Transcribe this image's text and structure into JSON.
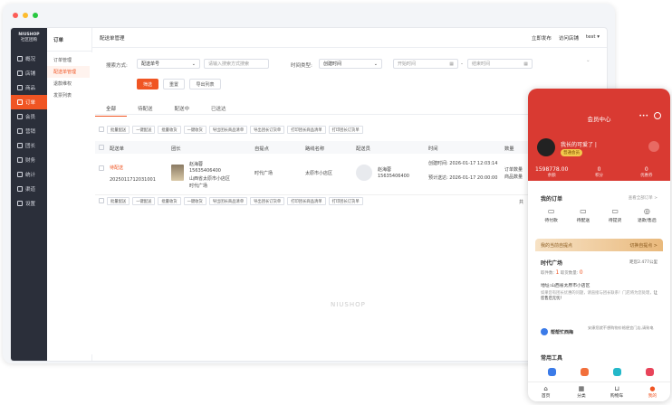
{
  "colors": {
    "accent": "#f05523",
    "phone_red": "#d93a32"
  },
  "window": {
    "dots": [
      "#fc5d57",
      "#fdbc2e",
      "#28c840"
    ]
  },
  "sidebar": {
    "logo": "NIUSHOP",
    "logo_sub": "社区团购",
    "items": [
      {
        "label": "概况",
        "icon": "dashboard-icon"
      },
      {
        "label": "店铺",
        "icon": "shop-icon"
      },
      {
        "label": "商品",
        "icon": "goods-icon"
      },
      {
        "label": "订单",
        "icon": "order-icon"
      },
      {
        "label": "会员",
        "icon": "member-icon"
      },
      {
        "label": "营销",
        "icon": "marketing-icon"
      },
      {
        "label": "团长",
        "icon": "leader-icon"
      },
      {
        "label": "财务",
        "icon": "finance-icon"
      },
      {
        "label": "统计",
        "icon": "stats-icon"
      },
      {
        "label": "渠道",
        "icon": "channel-icon"
      },
      {
        "label": "设置",
        "icon": "settings-icon"
      }
    ]
  },
  "submenu": {
    "title": "订单",
    "items": [
      "订单管理",
      "配送单管理",
      "退款维权",
      "发票列表"
    ]
  },
  "topbar": {
    "breadcrumb": "配送单管理",
    "links": [
      "立即发布",
      "访问店铺",
      "test"
    ]
  },
  "filters": {
    "search_label": "搜索方式:",
    "search_type": "配送单号",
    "search_placeholder": "请输入搜索方式搜索",
    "time_label": "时间类型:",
    "time_type": "创建时间",
    "start_placeholder": "开始时间",
    "sep": "-",
    "end_placeholder": "结束时间",
    "btn_filter": "筛选",
    "btn_reset": "重置",
    "btn_export": "导出列表"
  },
  "tabs": [
    "全部",
    "待配送",
    "配送中",
    "已送达"
  ],
  "batch": [
    "批量配送",
    "一键配送",
    "批量收货",
    "一键收货",
    "导出团长商品清单",
    "导出团长订货单",
    "打印团长商品清单",
    "打印团长订货单"
  ],
  "table": {
    "headers": [
      "配送单",
      "团长",
      "自提点",
      "路线名称",
      "配送员",
      "时间",
      "数量"
    ],
    "row": {
      "status": "待配送",
      "no": "2025011712031001",
      "leader_name": "赵海蓉",
      "leader_phone": "15635406400",
      "leader_addr": "山西省太原市小店区",
      "leader_place": "时代广场",
      "pickup": "时代广场",
      "route": "太原市小店区",
      "courier_name": "赵海蓉",
      "courier_phone": "15635406400",
      "created": "创建时间: 2026-01-17 12:03:14",
      "planned": "预计送达: 2026-01-17 20:00:00",
      "qty1": "订单数量",
      "qty2": "商品数量"
    },
    "more": "共"
  },
  "watermark": "NIUSHOP",
  "phone": {
    "title": "会员中心",
    "user": "我长的可爱了 |",
    "badge": "普通会员",
    "stats": [
      {
        "v": "1598778.00",
        "l": "余额"
      },
      {
        "v": "0",
        "l": "积分"
      },
      {
        "v": "0",
        "l": "优惠券"
      }
    ],
    "orders_title": "我的订单",
    "orders_more": "查看全部订单 >",
    "order_items": [
      "待付款",
      "待配送",
      "待提货",
      "退款/售后"
    ],
    "pickup_banner": "我的当前自提点",
    "pickup_switch": "切换自提点 >",
    "pickup_name": "时代广场",
    "pickup_dist": "距您2.477公里",
    "pickup_meta": "取件数:",
    "pickup_v1": "1",
    "pickup_meta2": "取货数量:",
    "pickup_v2": "0",
    "pickup_addr": "地址:山西省太原市小店区",
    "pickup_note": "如果您有团长优惠的问题，请直接与团长联系！门店将为您处理，",
    "pickup_link": "让您售后无忧！",
    "leader": "帮帮忙西梅",
    "leader_note": "安康您就不想购物价格便宜门店,请致电",
    "tools_title": "常用工具",
    "tabbar": [
      "首页",
      "分类",
      "购物车",
      "我的"
    ]
  }
}
